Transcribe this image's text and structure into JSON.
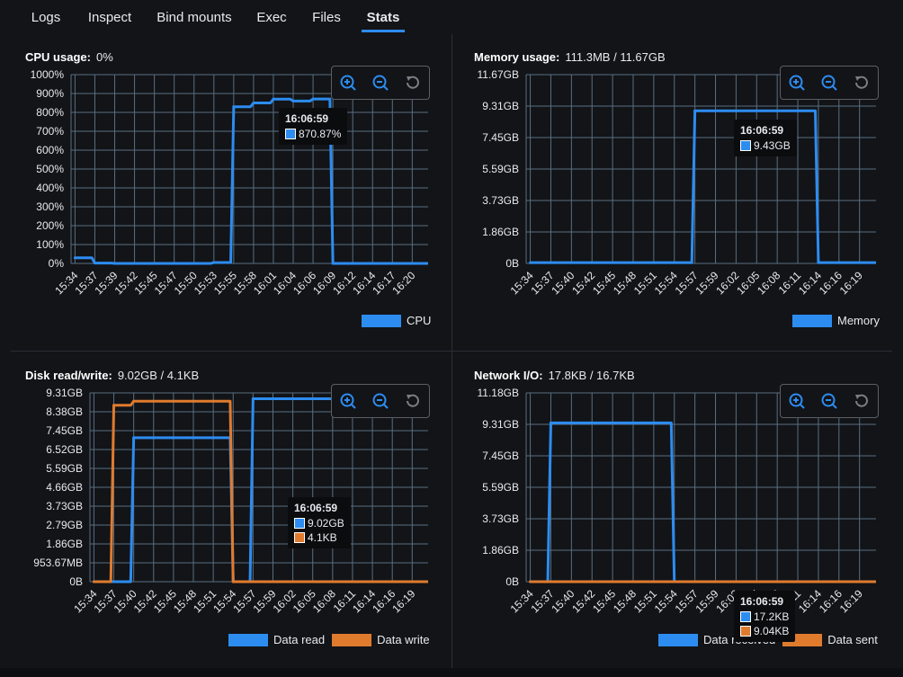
{
  "tabs": [
    {
      "label": "Logs",
      "active": false
    },
    {
      "label": "Inspect",
      "active": false
    },
    {
      "label": "Bind mounts",
      "active": false
    },
    {
      "label": "Exec",
      "active": false
    },
    {
      "label": "Files",
      "active": false
    },
    {
      "label": "Stats",
      "active": true
    }
  ],
  "colors": {
    "blue": "#2d8cf0",
    "orange": "#e07b2e",
    "grid": "#5a6e80"
  },
  "panels": {
    "cpu": {
      "title": "CPU usage:",
      "value": "0%",
      "y_ticks": [
        "1000%",
        "900%",
        "800%",
        "700%",
        "600%",
        "500%",
        "400%",
        "300%",
        "200%",
        "100%",
        "0%"
      ],
      "x_ticks": [
        "15:34",
        "15:37",
        "15:39",
        "15:42",
        "15:45",
        "15:47",
        "15:50",
        "15:53",
        "15:55",
        "15:58",
        "16:01",
        "16:04",
        "16:06",
        "16:09",
        "16:12",
        "16:14",
        "16:17",
        "16:20"
      ],
      "legend": [
        "CPU"
      ],
      "tooltip": {
        "time": "16:06:59",
        "rows": [
          "870.87%"
        ]
      },
      "tools": [
        "zoom-in-icon",
        "zoom-out-icon",
        "reset-icon"
      ]
    },
    "memory": {
      "title": "Memory usage:",
      "value": "111.3MB / 11.67GB",
      "y_ticks": [
        "11.67GB",
        "9.31GB",
        "7.45GB",
        "5.59GB",
        "3.73GB",
        "1.86GB",
        "0B"
      ],
      "x_ticks": [
        "15:34",
        "15:37",
        "15:40",
        "15:42",
        "15:45",
        "15:48",
        "15:51",
        "15:54",
        "15:57",
        "15:59",
        "16:02",
        "16:05",
        "16:08",
        "16:11",
        "16:14",
        "16:16",
        "16:19"
      ],
      "legend": [
        "Memory"
      ],
      "tooltip": {
        "time": "16:06:59",
        "rows": [
          "9.43GB"
        ]
      }
    },
    "disk": {
      "title": "Disk read/write:",
      "value": "9.02GB / 4.1KB",
      "y_ticks": [
        "9.31GB",
        "8.38GB",
        "7.45GB",
        "6.52GB",
        "5.59GB",
        "4.66GB",
        "3.73GB",
        "2.79GB",
        "1.86GB",
        "953.67MB",
        "0B"
      ],
      "x_ticks": [
        "15:34",
        "15:37",
        "15:40",
        "15:42",
        "15:45",
        "15:48",
        "15:51",
        "15:54",
        "15:57",
        "15:59",
        "16:02",
        "16:05",
        "16:08",
        "16:11",
        "16:14",
        "16:16",
        "16:19"
      ],
      "legend": [
        "Data read",
        "Data write"
      ],
      "tooltip": {
        "time": "16:06:59",
        "rows": [
          "9.02GB",
          "4.1KB"
        ]
      }
    },
    "network": {
      "title": "Network I/O:",
      "value": "17.8KB / 16.7KB",
      "y_ticks": [
        "11.18GB",
        "9.31GB",
        "7.45GB",
        "5.59GB",
        "3.73GB",
        "1.86GB",
        "0B"
      ],
      "x_ticks": [
        "15:34",
        "15:37",
        "15:40",
        "15:42",
        "15:45",
        "15:48",
        "15:51",
        "15:54",
        "15:57",
        "15:59",
        "16:02",
        "16:05",
        "16:08",
        "16:11",
        "16:14",
        "16:16",
        "16:19"
      ],
      "legend": [
        "Data received",
        "Data sent"
      ],
      "tooltip": {
        "time": "16:06:59",
        "rows": [
          "17.2KB",
          "9.04KB"
        ]
      }
    }
  },
  "chart_data": [
    {
      "type": "line",
      "title": "CPU usage:",
      "ylim": [
        0,
        1000
      ],
      "x": [
        "15:34",
        "15:37",
        "15:39",
        "15:42",
        "15:45",
        "15:47",
        "15:50",
        "15:53",
        "15:55",
        "15:58",
        "16:01",
        "16:04",
        "16:06",
        "16:09",
        "16:12",
        "16:14",
        "16:17",
        "16:20"
      ],
      "series": [
        {
          "name": "CPU",
          "values": [
            30,
            2,
            0,
            0,
            0,
            0,
            0,
            5,
            830,
            850,
            870,
            860,
            871,
            0,
            0,
            0,
            0,
            0
          ]
        }
      ]
    },
    {
      "type": "line",
      "title": "Memory usage:",
      "ylim": [
        0,
        11.67
      ],
      "x": [
        "15:34",
        "15:37",
        "15:40",
        "15:42",
        "15:45",
        "15:48",
        "15:51",
        "15:54",
        "15:57",
        "15:59",
        "16:02",
        "16:05",
        "16:08",
        "16:11",
        "16:14",
        "16:16",
        "16:19"
      ],
      "series": [
        {
          "name": "Memory",
          "values": [
            0.05,
            0.05,
            0.05,
            0.05,
            0.05,
            0.05,
            0.05,
            0.05,
            9.43,
            9.43,
            9.43,
            9.43,
            9.43,
            9.43,
            0.05,
            0.05,
            0.05
          ]
        }
      ]
    },
    {
      "type": "line",
      "title": "Disk read/write:",
      "ylim": [
        0,
        9.31
      ],
      "x": [
        "15:34",
        "15:37",
        "15:40",
        "15:42",
        "15:45",
        "15:48",
        "15:51",
        "15:54",
        "15:57",
        "15:59",
        "16:02",
        "16:05",
        "16:08",
        "16:11",
        "16:14",
        "16:16",
        "16:19"
      ],
      "series": [
        {
          "name": "Data read",
          "values": [
            0,
            0,
            7.1,
            7.1,
            7.1,
            7.1,
            7.1,
            0,
            9.02,
            9.02,
            9.02,
            9.02,
            9.02,
            9.02,
            9.02,
            9.02,
            9.02
          ]
        },
        {
          "name": "Data write",
          "values": [
            0,
            8.7,
            8.9,
            8.9,
            8.9,
            8.9,
            8.9,
            0,
            0,
            0,
            0,
            0,
            0,
            0,
            0,
            0,
            0
          ]
        }
      ]
    },
    {
      "type": "line",
      "title": "Network I/O:",
      "ylim": [
        0,
        11.18
      ],
      "x": [
        "15:34",
        "15:37",
        "15:40",
        "15:42",
        "15:45",
        "15:48",
        "15:51",
        "15:54",
        "15:57",
        "15:59",
        "16:02",
        "16:05",
        "16:08",
        "16:11",
        "16:14",
        "16:16",
        "16:19"
      ],
      "series": [
        {
          "name": "Data received",
          "values": [
            0,
            9.4,
            9.4,
            9.4,
            9.4,
            9.4,
            9.4,
            0,
            0,
            0,
            0,
            0,
            0,
            0,
            0,
            0,
            0
          ]
        },
        {
          "name": "Data sent",
          "values": [
            0,
            0,
            0,
            0,
            0,
            0,
            0,
            0,
            0,
            0,
            0,
            0,
            0,
            0,
            0,
            0,
            0
          ]
        }
      ]
    }
  ]
}
